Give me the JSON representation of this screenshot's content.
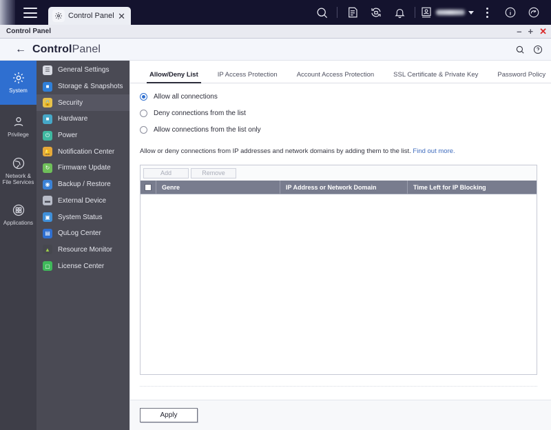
{
  "desktop": {
    "hamburger_name": "main-menu",
    "tab": {
      "label": "Control Panel",
      "icon": "gear-icon",
      "close_label": "✕"
    },
    "tray": {
      "search_icon": "search-icon",
      "notes_icon": "notes-icon",
      "sync_icon": "sync-icon",
      "bell_icon": "bell-icon",
      "user_icon": "user-avatar-icon",
      "more_icon": "more-vertical-icon",
      "info_icon": "info-icon",
      "dashboard_icon": "dashboard-icon"
    }
  },
  "window": {
    "title": "Control Panel",
    "minimize": "–",
    "maximize": "+",
    "close": "✕"
  },
  "header": {
    "back_icon": "back-arrow-icon",
    "title_bold": "Control",
    "title_light": "Panel",
    "search_icon": "search-icon",
    "help_icon": "help-icon"
  },
  "rail": {
    "items": [
      {
        "label": "System",
        "icon": "gear-icon",
        "active": true
      },
      {
        "label": "Privilege",
        "icon": "user-icon",
        "active": false
      },
      {
        "label": "Network &\nFile Services",
        "icon": "globe-icon",
        "active": false
      },
      {
        "label": "Applications",
        "icon": "grid-icon",
        "active": false
      }
    ]
  },
  "menu": {
    "items": [
      {
        "label": "General Settings",
        "icon": "clipboard-icon",
        "color": "#d8dae2",
        "active": false
      },
      {
        "label": "Storage & Snapshots",
        "icon": "storage-icon",
        "color": "#2f7fd8",
        "active": false
      },
      {
        "label": "Security",
        "icon": "lock-icon",
        "color": "#e8c24a",
        "active": true
      },
      {
        "label": "Hardware",
        "icon": "hardware-icon",
        "color": "#46a8c8",
        "active": false
      },
      {
        "label": "Power",
        "icon": "power-icon",
        "color": "#3fb8a0",
        "active": false
      },
      {
        "label": "Notification Center",
        "icon": "bell-icon",
        "color": "#e6a93a",
        "active": false
      },
      {
        "label": "Firmware Update",
        "icon": "firmware-icon",
        "color": "#6fbf5a",
        "active": false
      },
      {
        "label": "Backup / Restore",
        "icon": "backup-icon",
        "color": "#3b82d6",
        "active": false
      },
      {
        "label": "External Device",
        "icon": "external-device-icon",
        "color": "#b8bcc8",
        "active": false
      },
      {
        "label": "System Status",
        "icon": "monitor-icon",
        "color": "#3f8fd8",
        "active": false
      },
      {
        "label": "QuLog Center",
        "icon": "qulog-icon",
        "color": "#2f6fd0",
        "active": false
      },
      {
        "label": "Resource Monitor",
        "icon": "resource-monitor-icon",
        "color": "#7fbf4a",
        "active": false
      },
      {
        "label": "License Center",
        "icon": "license-icon",
        "color": "#3fb85a",
        "active": false
      }
    ]
  },
  "main": {
    "tabs": [
      {
        "label": "Allow/Deny List",
        "active": true
      },
      {
        "label": "IP Access Protection",
        "active": false
      },
      {
        "label": "Account Access Protection",
        "active": false
      },
      {
        "label": "SSL Certificate & Private Key",
        "active": false
      },
      {
        "label": "Password Policy",
        "active": false
      }
    ],
    "radios": [
      {
        "label": "Allow all connections",
        "checked": true
      },
      {
        "label": "Deny connections from the list",
        "checked": false
      },
      {
        "label": "Allow connections from the list only",
        "checked": false
      }
    ],
    "description": "Allow or deny connections from IP addresses and network domains by adding them to the list.",
    "description_link": "Find out more.",
    "table": {
      "add_label": "Add",
      "remove_label": "Remove",
      "columns": [
        "Genre",
        "IP Address or Network Domain",
        "Time Left for IP Blocking"
      ],
      "rows": []
    },
    "apply_label": "Apply"
  },
  "colors": {
    "accent": "#2f6fd0",
    "rail_bg": "#3e3e48",
    "menu_bg": "#4a4a54",
    "table_header": "#787c8e",
    "link": "#3e6bbd"
  }
}
